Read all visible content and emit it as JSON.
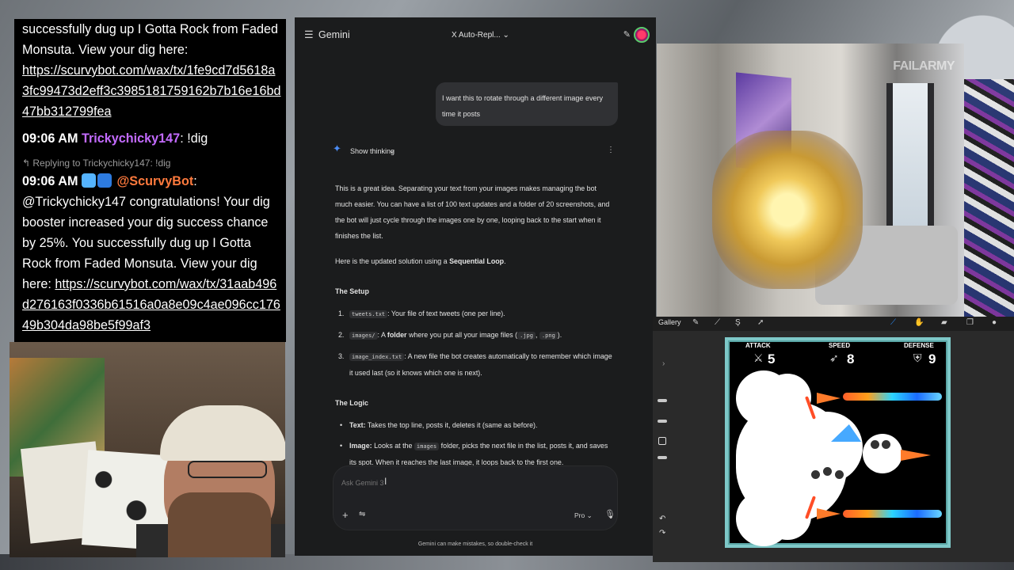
{
  "chat": {
    "msg1_text": "successfully dug up I Gotta Rock from Faded Monsuta. View your dig here:",
    "msg1_link": "https://scurvybot.com/wax/tx/1fe9cd7d5618a3fc99473d2eff3c3985181759162b7b16e16bd47bb312799fea",
    "msg2_time": "09:06 AM",
    "msg2_user": "Trickychicky147",
    "msg2_text": ": !dig",
    "msg3_reply": "Replying to Trickychicky147: !dig",
    "msg3_time": "09:06 AM",
    "msg3_user": "@ScurvyBot",
    "msg3_text": ": @Trickychicky147 congratulations! Your dig booster increased your dig success chance by 25%. You successfully dug up I Gotta Rock from Faded Monsuta. View your dig here:",
    "msg3_link": "https://scurvybot.com/wax/tx/31aab496d276163f0336b61516a0a8e09c4ae096cc17649b304da98be5f99af3"
  },
  "gemini": {
    "brand": "Gemini",
    "chat_title": "X Auto-Repl...",
    "user_message": "I want this to rotate through a different image every time it posts",
    "show_thinking": "Show thinking",
    "intro": "This is a great idea. Separating your text from your images makes managing the bot much easier. You can have a list of 100 text updates and a folder of 20 screenshots, and the bot will just cycle through the images one by one, looping back to the start when it finishes the list.",
    "solution_prefix": "Here is the updated solution using a ",
    "solution_bold": "Sequential Loop",
    "solution_suffix": ".",
    "setup_heading": "The Setup",
    "setup_items": [
      {
        "num": "1.",
        "code": "tweets.txt",
        "text": ": Your file of text tweets (one per line)."
      },
      {
        "num": "2.",
        "code": "images/",
        "text_pre": ": A ",
        "bold": "folder",
        "text_mid": " where you put all your image files (",
        "code2": ".jpg",
        "sep": ", ",
        "code3": ".png",
        "text_end": ")."
      },
      {
        "num": "3.",
        "code": "image_index.txt",
        "text": ": A new file the bot creates automatically to remember which image it used last (so it knows which one is next)."
      }
    ],
    "logic_heading": "The Logic",
    "logic_items": [
      {
        "bold": "Text:",
        "text": " Takes the top line, posts it, deletes it (same as before)."
      },
      {
        "bold": "Image:",
        "text_pre": " Looks at the ",
        "code": "images",
        "text_post": " folder, picks the next file in the list, posts it, and saves its spot. When it reaches the last image, it loops back to the first one."
      }
    ],
    "input_placeholder": "Ask Gemini 3",
    "model": "Pro",
    "disclaimer": "Gemini can make mistakes, so double-check it"
  },
  "video": {
    "logo": "FAILARMY"
  },
  "procreate": {
    "gallery": "Gallery",
    "attack_label": "ATTACK",
    "attack_value": "5",
    "speed_label": "SPEED",
    "speed_value": "8",
    "defense_label": "DEFENSE",
    "defense_value": "9"
  }
}
